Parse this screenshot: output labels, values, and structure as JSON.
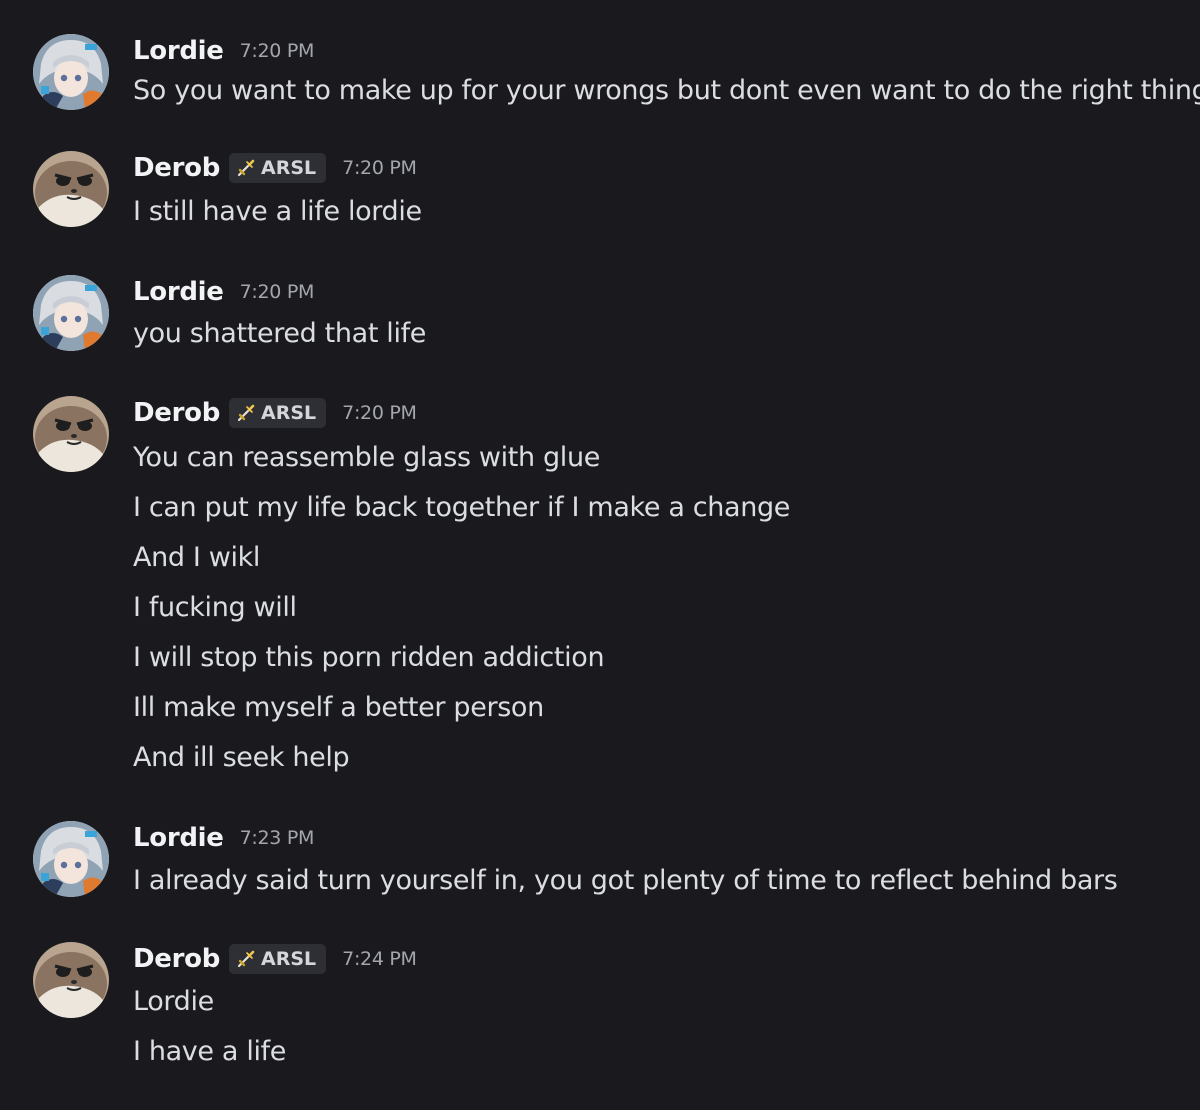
{
  "users": {
    "lordie": {
      "name": "Lordie"
    },
    "derob": {
      "name": "Derob",
      "tag": "ARSL"
    }
  },
  "messages": [
    {
      "author": "Lordie",
      "time": "7:20 PM",
      "lines": [
        "So you want to make up for your wrongs but dont even want to do the right thing"
      ]
    },
    {
      "author": "Derob",
      "tag": "ARSL",
      "time": "7:20 PM",
      "lines": [
        "I still have a life lordie"
      ]
    },
    {
      "author": "Lordie",
      "time": "7:20 PM",
      "lines": [
        "you shattered that life"
      ]
    },
    {
      "author": "Derob",
      "tag": "ARSL",
      "time": "7:20 PM",
      "lines": [
        "You can reassemble glass with glue",
        "I can put my life back together if I make a change",
        "And I wikl",
        "I fucking will",
        "I will stop this porn ridden addiction",
        "Ill make myself a better person",
        "And ill seek help"
      ]
    },
    {
      "author": "Lordie",
      "time": "7:23 PM",
      "lines": [
        "I already said turn yourself in, you got plenty of time to reflect behind bars"
      ]
    },
    {
      "author": "Derob",
      "tag": "ARSL",
      "time": "7:24 PM",
      "lines": [
        "Lordie",
        "I have a life"
      ]
    }
  ],
  "theme": {
    "background": "#1a1a1e",
    "text": "#dbdee1",
    "username": "#f2f3f5",
    "timestamp": "#a3a6ad",
    "tag_bg": "#2e2f34"
  }
}
